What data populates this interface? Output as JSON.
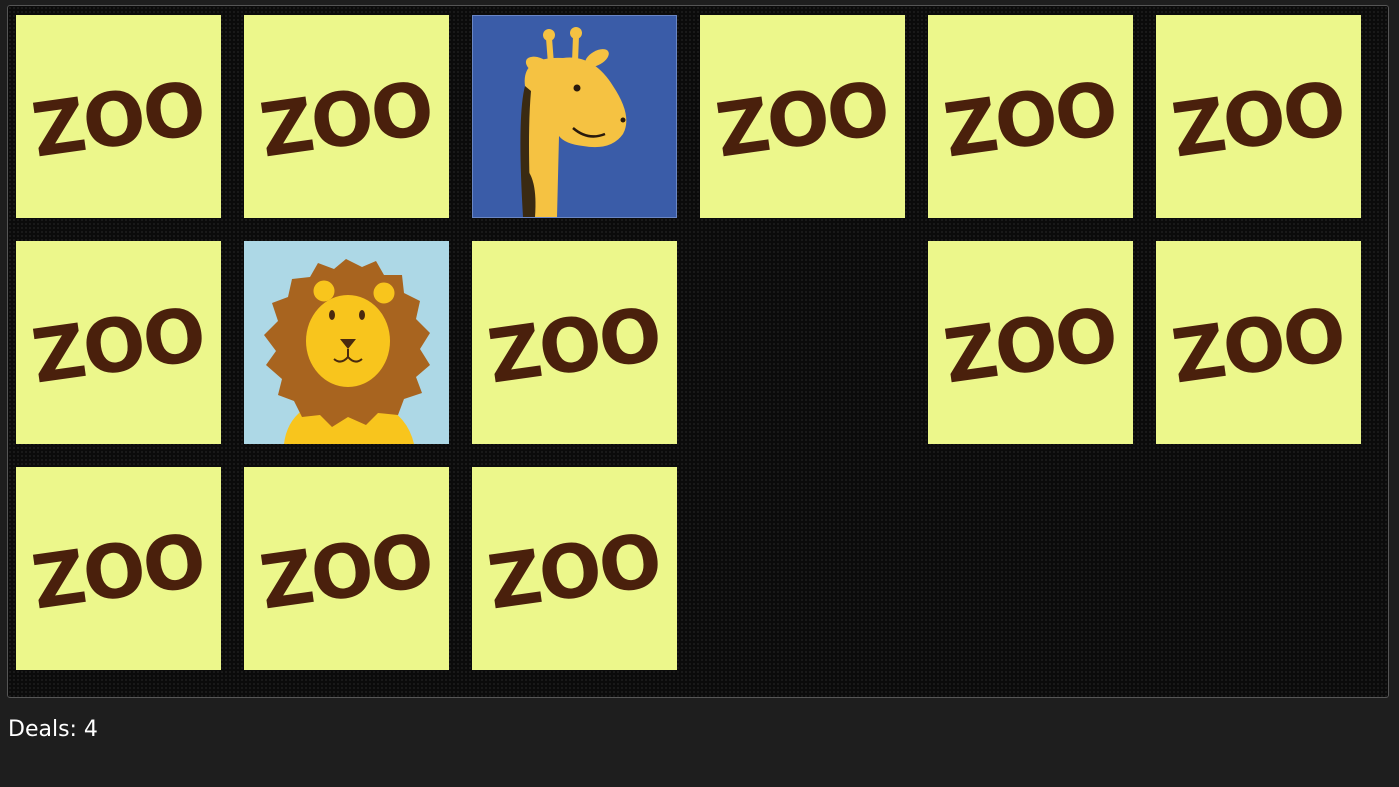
{
  "board": {
    "rows": 3,
    "cols": 6,
    "card_back_text": "ZOO",
    "cards": [
      {
        "row": 0,
        "col": 0,
        "state": "hidden"
      },
      {
        "row": 0,
        "col": 1,
        "state": "hidden"
      },
      {
        "row": 0,
        "col": 2,
        "state": "revealed",
        "animal": "giraffe"
      },
      {
        "row": 0,
        "col": 3,
        "state": "hidden"
      },
      {
        "row": 0,
        "col": 4,
        "state": "hidden"
      },
      {
        "row": 0,
        "col": 5,
        "state": "hidden"
      },
      {
        "row": 1,
        "col": 0,
        "state": "hidden"
      },
      {
        "row": 1,
        "col": 1,
        "state": "revealed",
        "animal": "lion"
      },
      {
        "row": 1,
        "col": 2,
        "state": "hidden"
      },
      {
        "row": 1,
        "col": 3,
        "state": "removed"
      },
      {
        "row": 1,
        "col": 4,
        "state": "hidden"
      },
      {
        "row": 1,
        "col": 5,
        "state": "hidden"
      },
      {
        "row": 2,
        "col": 0,
        "state": "hidden"
      },
      {
        "row": 2,
        "col": 1,
        "state": "hidden"
      },
      {
        "row": 2,
        "col": 2,
        "state": "hidden"
      },
      {
        "row": 2,
        "col": 3,
        "state": "removed"
      },
      {
        "row": 2,
        "col": 4,
        "state": "removed"
      },
      {
        "row": 2,
        "col": 5,
        "state": "removed"
      }
    ]
  },
  "colors": {
    "card_back": "#ecf78b",
    "zoo_text": "#4a200c",
    "giraffe_bg": "#3a5ca8",
    "lion_bg": "#add8e6"
  },
  "status": {
    "deals_label": "Deals: 4"
  }
}
